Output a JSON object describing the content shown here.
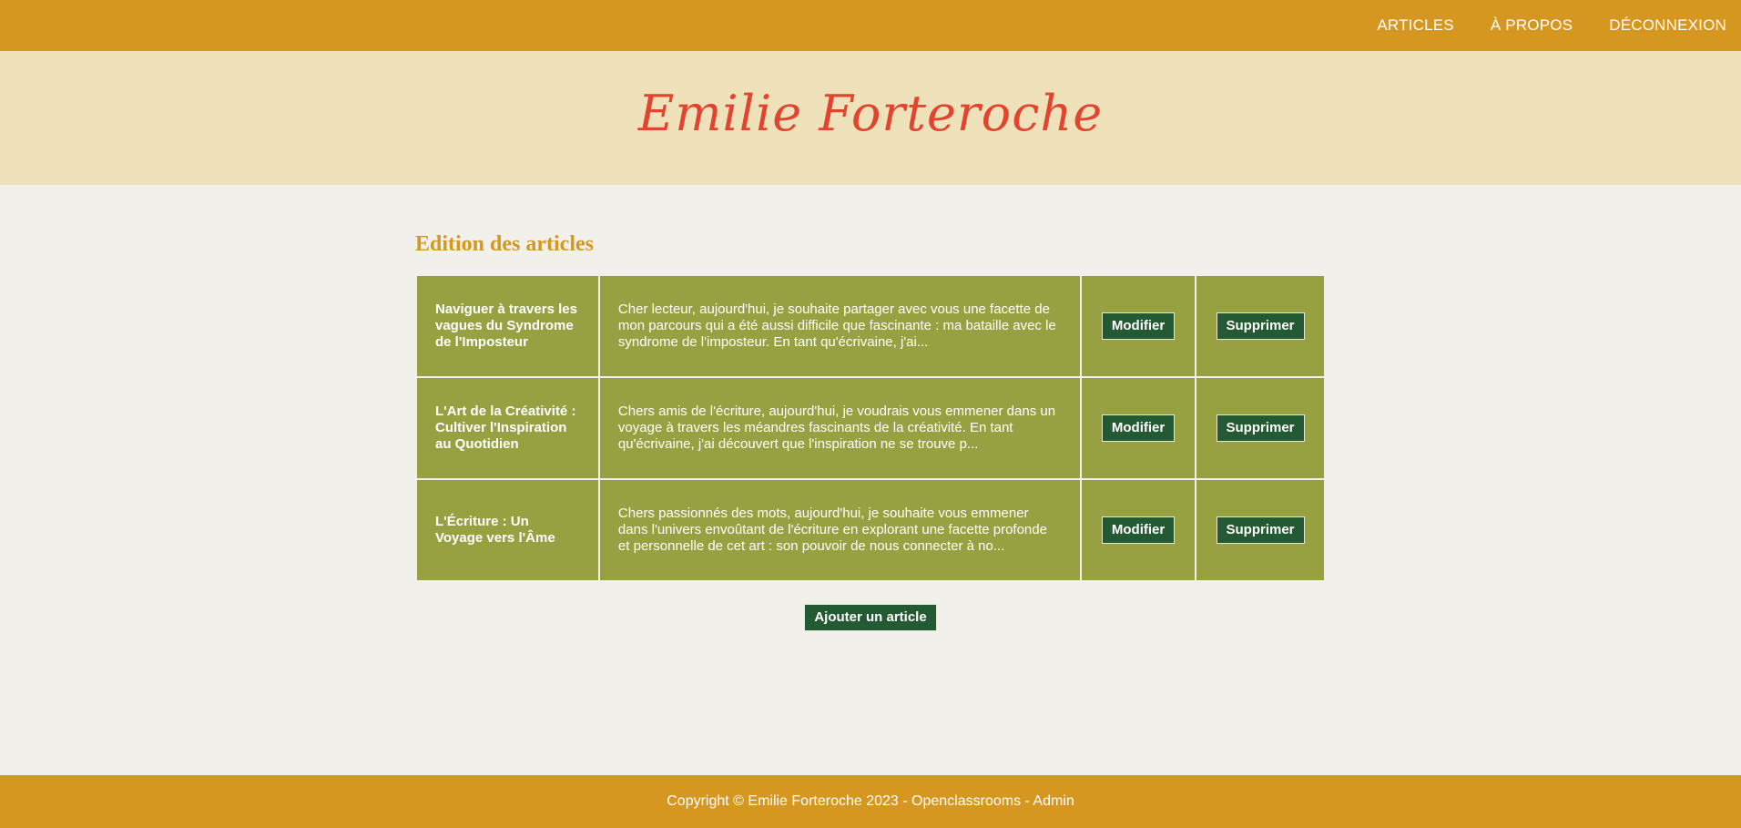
{
  "nav": {
    "items": [
      {
        "label": "ARTICLES"
      },
      {
        "label": "À PROPOS"
      },
      {
        "label": "DÉCONNEXION"
      }
    ]
  },
  "banner": {
    "site_title": "Emilie Forteroche"
  },
  "main": {
    "section_title": "Edition des articles",
    "articles": [
      {
        "title": "Naviguer à travers les vagues du Syndrome de l'Imposteur",
        "excerpt": "Cher lecteur, aujourd'hui, je souhaite partager avec vous une facette de mon parcours qui a été aussi difficile que fascinante : ma bataille avec le syndrome de l'imposteur. En tant qu'écrivaine, j'ai...",
        "edit_label": "Modifier",
        "delete_label": "Supprimer"
      },
      {
        "title": "L'Art de la Créativité : Cultiver l'Inspiration au Quotidien",
        "excerpt": "Chers amis de l'écriture, aujourd'hui, je voudrais vous emmener dans un voyage à travers les méandres fascinants de la créativité. En tant qu'écrivaine, j'ai découvert que l'inspiration ne se trouve p...",
        "edit_label": "Modifier",
        "delete_label": "Supprimer"
      },
      {
        "title": "L'Écriture : Un Voyage vers l'Âme",
        "excerpt": "Chers passionnés des mots, aujourd'hui, je souhaite vous emmener dans l'univers envoûtant de l'écriture en explorant une facette profonde et personnelle de cet art : son pouvoir de nous connecter à no...",
        "edit_label": "Modifier",
        "delete_label": "Supprimer"
      }
    ],
    "add_label": "Ajouter un article"
  },
  "footer": {
    "text": "Copyright © Emilie Forteroche 2023 - Openclassrooms - Admin"
  },
  "colors": {
    "header_bg": "#d69721",
    "banner_bg": "#efe2bb",
    "title_red": "#e1452f",
    "page_bg": "#f2f0ea",
    "row_olive": "#98a142",
    "button_green": "#235a33"
  }
}
